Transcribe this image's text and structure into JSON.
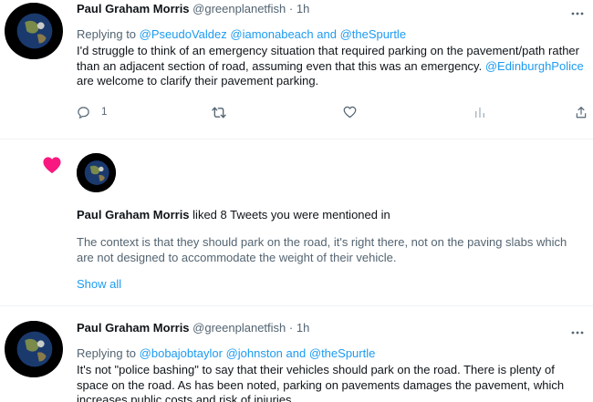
{
  "tweet1": {
    "name": "Paul Graham Morris",
    "handle": "@greenplanetfish",
    "dot": "·",
    "time": "1h",
    "replying_prefix": "Replying to",
    "replying_user1": "@PseudoValdez",
    "replying_user2": "@iamonabeach",
    "replying_and": "and",
    "replying_user3": "@theSpurtle",
    "text_part1": "I'd struggle to think of an emergency situation that required parking on the pavement/path rather than an adjacent section of road, assuming even that this was an emergency.",
    "mention": "@EdinburghPolice",
    "text_part2": "are welcome to clarify their pavement parking.",
    "reply_count": "1"
  },
  "notification": {
    "name": "Paul Graham Morris",
    "action_text": "liked 8 Tweets you were mentioned in",
    "quoted_text": "The context is that they should park on the road, it's right there, not on the paving slabs which are not designed to accommodate the weight of their vehicle.",
    "show_all": "Show all"
  },
  "tweet2": {
    "name": "Paul Graham Morris",
    "handle": "@greenplanetfish",
    "dot": "·",
    "time": "1h",
    "replying_prefix": "Replying to",
    "replying_user1": "@bobajobtaylor",
    "replying_user2": "@johnston",
    "replying_and": "and",
    "replying_user3": "@theSpurtle",
    "text": "It's not \"police bashing\" to say that their vehicles should park on the road. There is plenty of space on the road. As has been noted, parking on pavements damages the pavement, which increases public costs and risk of injuries."
  },
  "colors": {
    "accent": "#1d9bf0",
    "muted": "#536471",
    "like": "#f91880",
    "divider": "#eff3f4"
  },
  "icons": [
    "globe-avatar",
    "more-icon",
    "reply-icon",
    "retweet-icon",
    "like-icon",
    "analytics-icon",
    "share-icon",
    "heart-icon"
  ]
}
